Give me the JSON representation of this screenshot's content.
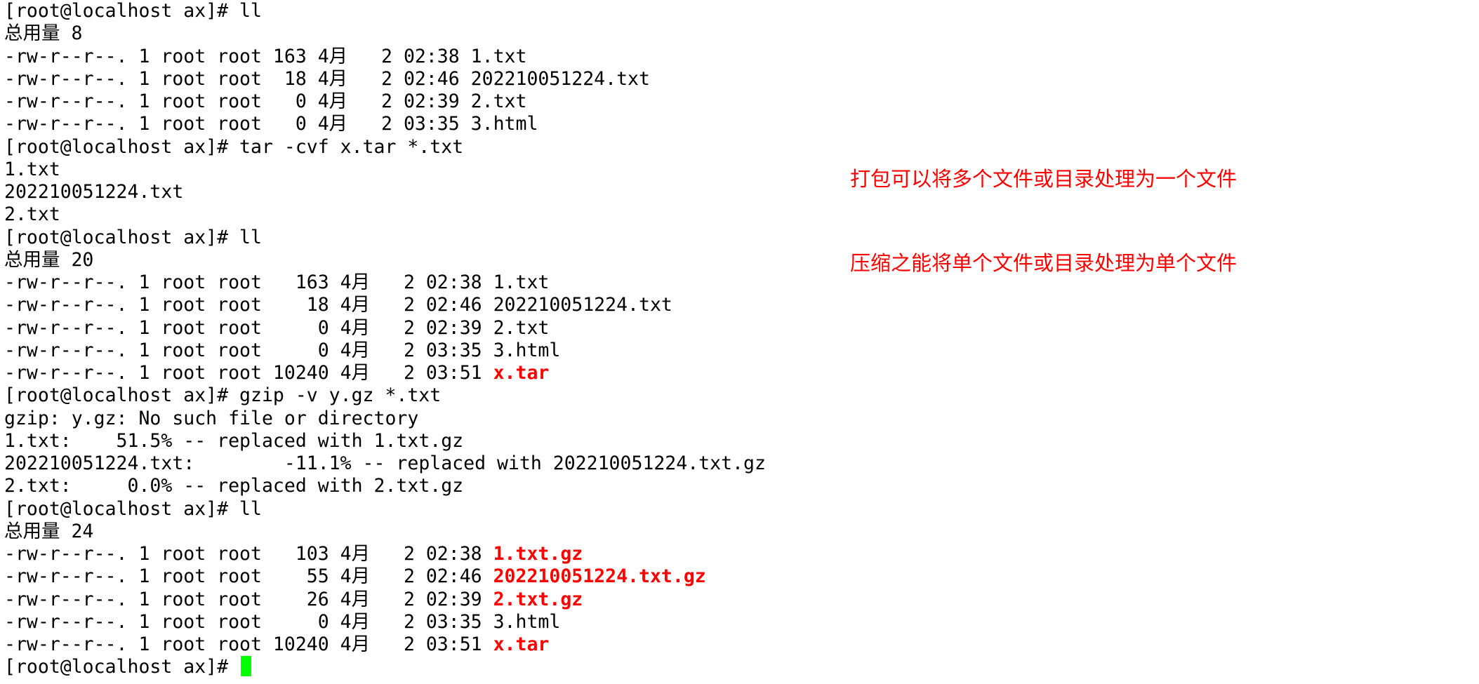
{
  "terminal": {
    "prompt": "[root@localhost ax]# ",
    "lines": [
      {
        "text": "[root@localhost ax]# ll"
      },
      {
        "text": "总用量 8"
      },
      {
        "text": "-rw-r--r--. 1 root root 163 4月   2 02:38 1.txt"
      },
      {
        "text": "-rw-r--r--. 1 root root  18 4月   2 02:46 202210051224.txt"
      },
      {
        "text": "-rw-r--r--. 1 root root   0 4月   2 02:39 2.txt"
      },
      {
        "text": "-rw-r--r--. 1 root root   0 4月   2 03:35 3.html"
      },
      {
        "text": "[root@localhost ax]# tar -cvf x.tar *.txt"
      },
      {
        "text": "1.txt"
      },
      {
        "text": "202210051224.txt"
      },
      {
        "text": "2.txt"
      },
      {
        "text": "[root@localhost ax]# ll"
      },
      {
        "text": "总用量 20"
      },
      {
        "text": "-rw-r--r--. 1 root root   163 4月   2 02:38 1.txt"
      },
      {
        "text": "-rw-r--r--. 1 root root    18 4月   2 02:46 202210051224.txt"
      },
      {
        "text": "-rw-r--r--. 1 root root     0 4月   2 02:39 2.txt"
      },
      {
        "text": "-rw-r--r--. 1 root root     0 4月   2 03:35 3.html"
      },
      {
        "text": "-rw-r--r--. 1 root root 10240 4月   2 03:51 ",
        "hl": "x.tar"
      },
      {
        "text": "[root@localhost ax]# gzip -v y.gz *.txt"
      },
      {
        "text": "gzip: y.gz: No such file or directory"
      },
      {
        "text": "1.txt:\t  51.5% -- replaced with 1.txt.gz"
      },
      {
        "text": "202210051224.txt:\t -11.1% -- replaced with 202210051224.txt.gz"
      },
      {
        "text": "2.txt:\t   0.0% -- replaced with 2.txt.gz"
      },
      {
        "text": "[root@localhost ax]# ll"
      },
      {
        "text": "总用量 24"
      },
      {
        "text": "-rw-r--r--. 1 root root   103 4月   2 02:38 ",
        "hl": "1.txt.gz"
      },
      {
        "text": "-rw-r--r--. 1 root root    55 4月   2 02:46 ",
        "hl": "202210051224.txt.gz"
      },
      {
        "text": "-rw-r--r--. 1 root root    26 4月   2 02:39 ",
        "hl": "2.txt.gz"
      },
      {
        "text": "-rw-r--r--. 1 root root     0 4月   2 03:35 3.html"
      },
      {
        "text": "-rw-r--r--. 1 root root 10240 4月   2 03:51 ",
        "hl": "x.tar"
      }
    ],
    "cursor_color": "#00ff00",
    "highlight_color": "#ff0000",
    "text_color": "#000000",
    "background_color": "#ffffff"
  },
  "annotation": {
    "line1": "打包可以将多个文件或目录处理为一个文件",
    "line2": "压缩之能将单个文件或目录处理为单个文件",
    "color": "#ff0000"
  }
}
